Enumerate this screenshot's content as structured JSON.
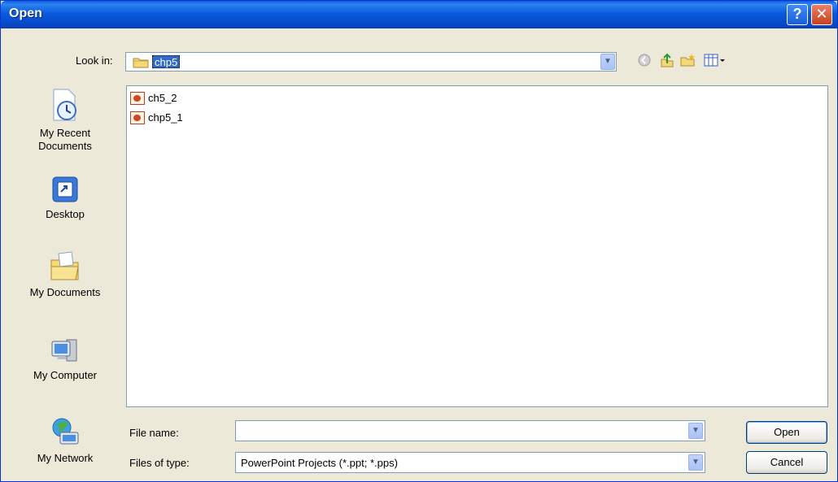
{
  "window": {
    "title": "Open"
  },
  "titlebar": {
    "help_glyph": "?",
    "close_glyph": "✕"
  },
  "look_in": {
    "label": "Look in:",
    "value": "chp5",
    "icon": "folder-icon"
  },
  "toolbar": {
    "icons": [
      "back-icon",
      "up-folder-icon",
      "new-folder-icon",
      "views-menu-icon"
    ]
  },
  "places": [
    {
      "label_line1": "My Recent",
      "label_line2": "Documents",
      "icon": "recent-documents-icon"
    },
    {
      "label_line1": "Desktop",
      "label_line2": "",
      "icon": "desktop-icon"
    },
    {
      "label_line1": "My Documents",
      "label_line2": "",
      "icon": "my-documents-icon"
    },
    {
      "label_line1": "My Computer",
      "label_line2": "",
      "icon": "my-computer-icon"
    },
    {
      "label_line1": "My Network",
      "label_line2": "",
      "icon": "my-network-icon"
    }
  ],
  "files": [
    {
      "name": "ch5_2",
      "icon": "powerpoint-file-icon"
    },
    {
      "name": "chp5_1",
      "icon": "powerpoint-file-icon"
    }
  ],
  "file_name": {
    "label": "File name:",
    "value": ""
  },
  "file_type": {
    "label": "Files of type:",
    "value": "PowerPoint Projects (*.ppt; *.pps)"
  },
  "buttons": {
    "open": "Open",
    "cancel": "Cancel"
  },
  "colors": {
    "titlebar": "#0b5bdc",
    "selection": "#316ac5",
    "dialog_bg": "#ece9d8"
  }
}
